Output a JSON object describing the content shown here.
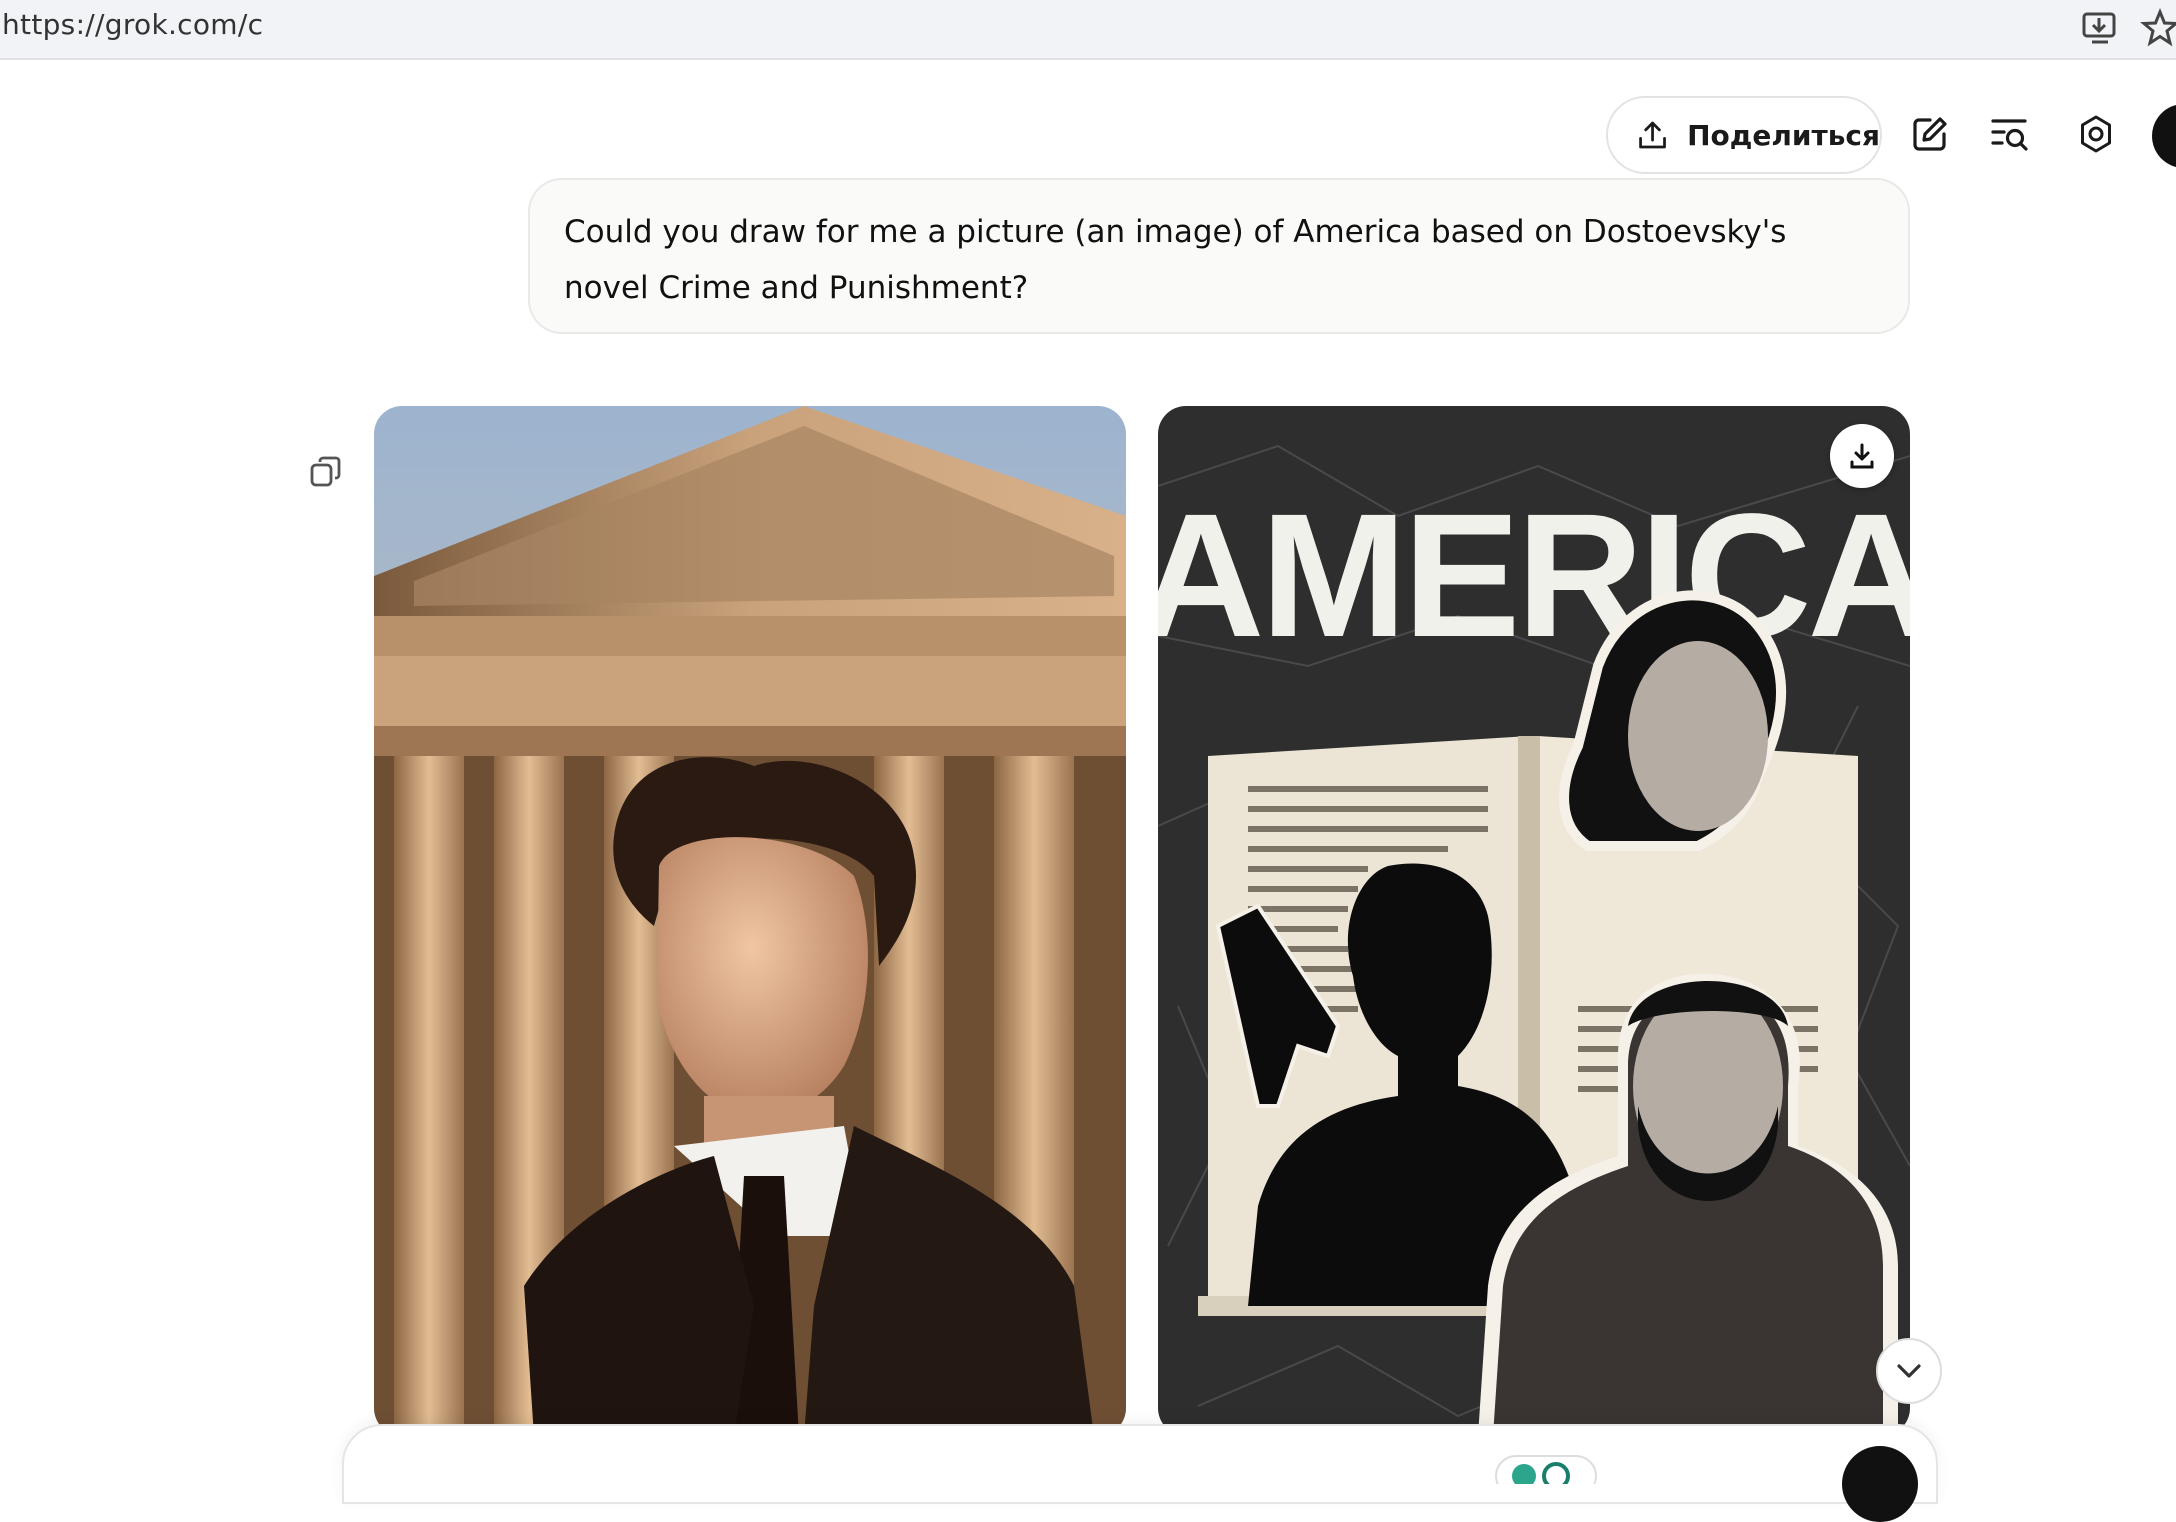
{
  "browser": {
    "url": "https://grok.com/c",
    "icons": [
      "install-app-icon",
      "bookmark-star-icon"
    ]
  },
  "toolbar": {
    "share_label": "Поделиться",
    "icons": [
      "share-upload-icon",
      "edit-icon",
      "history-search-icon",
      "settings-icon",
      "avatar"
    ]
  },
  "conversation": {
    "user_message": "Could you draw for me a picture (an image) of America based on Dostoevsky's novel Crime and Punishment?",
    "images": [
      {
        "name": "generated-image-1",
        "description_tags": [
          "man-in-suit",
          "neoclassical-building"
        ]
      },
      {
        "name": "generated-image-2",
        "poster_title": "AMERICA"
      }
    ],
    "image_actions": [
      "download-icon"
    ],
    "scroll_control": "chevron-down-icon"
  },
  "colors": {
    "page_bg": "#ffffff",
    "address_bar_bg": "#f1f3f6",
    "bubble_bg": "#fafaf9",
    "accent_dark": "#111111"
  }
}
